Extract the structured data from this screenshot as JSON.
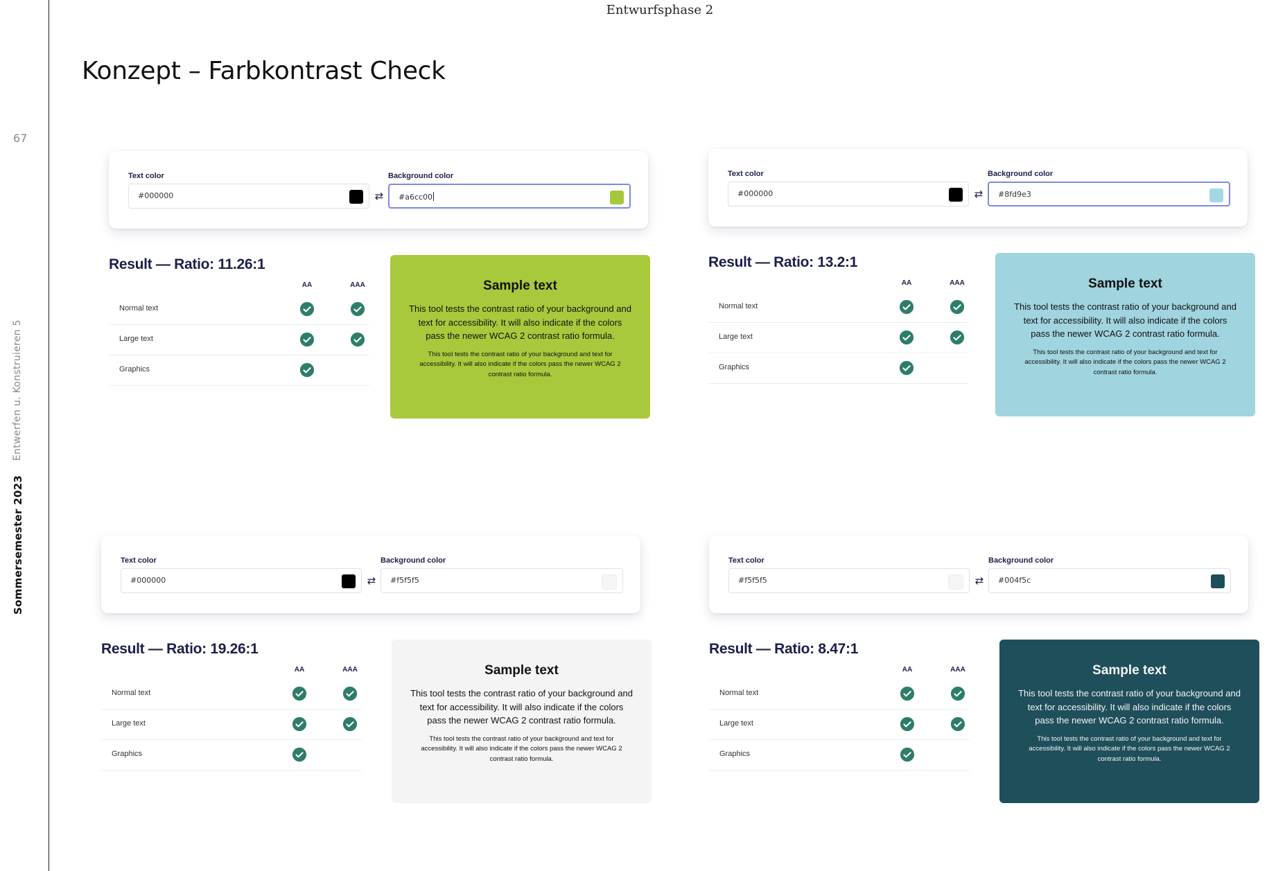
{
  "page": {
    "running_head": "Entwurfsphase 2",
    "title": "Konzept – Farbkontrast Check",
    "page_number": "67",
    "side_course": "Entwerfen u. Konstruieren 5",
    "side_semester": "Sommersemester 2023"
  },
  "labels": {
    "text_color": "Text color",
    "background_color": "Background color",
    "level_aa": "AA",
    "level_aaa": "AAA"
  },
  "icons": {
    "swap": "swap-arrows-icon",
    "check": "check-circle-icon",
    "check_color": "#2e7d6b"
  },
  "examples": [
    {
      "text_color": "#000000",
      "background_color": "#a6cc00",
      "background_focused": true,
      "result_heading": "Result — Ratio: 11.26:1",
      "text_swatch": "#000000",
      "bg_swatch": "#a6c93a",
      "card_bg": "#a9c93c",
      "card_fg": "#111111",
      "rows": [
        {
          "label": "Normal text",
          "aa": true,
          "aaa": true
        },
        {
          "label": "Large text",
          "aa": true,
          "aaa": true
        },
        {
          "label": "Graphics",
          "aa": true,
          "aaa": false
        }
      ],
      "sample_title": "Sample text",
      "sample_large": "This tool tests the contrast ratio of your background and text for accessibility. It will also indicate if the colors pass the newer WCAG 2 contrast ratio formula.",
      "sample_small": "This tool tests the contrast ratio of your background and text for accessibility. It will also indicate if the colors pass the newer WCAG 2 contrast ratio formula."
    },
    {
      "text_color": "#000000",
      "background_color": "#8fd9e3",
      "background_focused": true,
      "result_heading": "Result — Ratio: 13.2:1",
      "text_swatch": "#000000",
      "bg_swatch": "#a3d8e2",
      "card_bg": "#a0d4de",
      "card_fg": "#111111",
      "rows": [
        {
          "label": "Normal text",
          "aa": true,
          "aaa": true
        },
        {
          "label": "Large text",
          "aa": true,
          "aaa": true
        },
        {
          "label": "Graphics",
          "aa": true,
          "aaa": false
        }
      ],
      "sample_title": "Sample text",
      "sample_large": "This tool tests the contrast ratio of your background and text for accessibility. It will also indicate if the colors pass the newer WCAG 2 contrast ratio formula.",
      "sample_small": "This tool tests the contrast ratio of your background and text for accessibility. It will also indicate if the colors pass the newer WCAG 2 contrast ratio formula."
    },
    {
      "text_color": "#000000",
      "background_color": "#f5f5f5",
      "background_focused": false,
      "result_heading": "Result — Ratio: 19.26:1",
      "text_swatch": "#000000",
      "bg_swatch": "#f5f5f5",
      "card_bg": "#f4f4f4",
      "card_fg": "#111111",
      "rows": [
        {
          "label": "Normal text",
          "aa": true,
          "aaa": true
        },
        {
          "label": "Large text",
          "aa": true,
          "aaa": true
        },
        {
          "label": "Graphics",
          "aa": true,
          "aaa": false
        }
      ],
      "sample_title": "Sample text",
      "sample_large": "This tool tests the contrast ratio of your background and text for accessibility. It will also indicate if the colors pass the newer WCAG 2 contrast ratio formula.",
      "sample_small": "This tool tests the contrast ratio of your background and text for accessibility. It will also indicate if the colors pass the newer WCAG 2 contrast ratio formula."
    },
    {
      "text_color": "#f5f5f5",
      "background_color": "#004f5c",
      "background_focused": false,
      "result_heading": "Result — Ratio: 8.47:1",
      "text_swatch": "#f5f5f5",
      "bg_swatch": "#1e4d5a",
      "card_bg": "#1f4f5b",
      "card_fg": "#f5f5f5",
      "rows": [
        {
          "label": "Normal text",
          "aa": true,
          "aaa": true
        },
        {
          "label": "Large text",
          "aa": true,
          "aaa": true
        },
        {
          "label": "Graphics",
          "aa": true,
          "aaa": false
        }
      ],
      "sample_title": "Sample text",
      "sample_large": "This tool tests the contrast ratio of your background and text for accessibility. It will also indicate if the colors pass the newer WCAG 2 contrast ratio formula.",
      "sample_small": "This tool tests the contrast ratio of your background and text for accessibility. It will also indicate if the colors pass the newer WCAG 2 contrast ratio formula."
    }
  ]
}
